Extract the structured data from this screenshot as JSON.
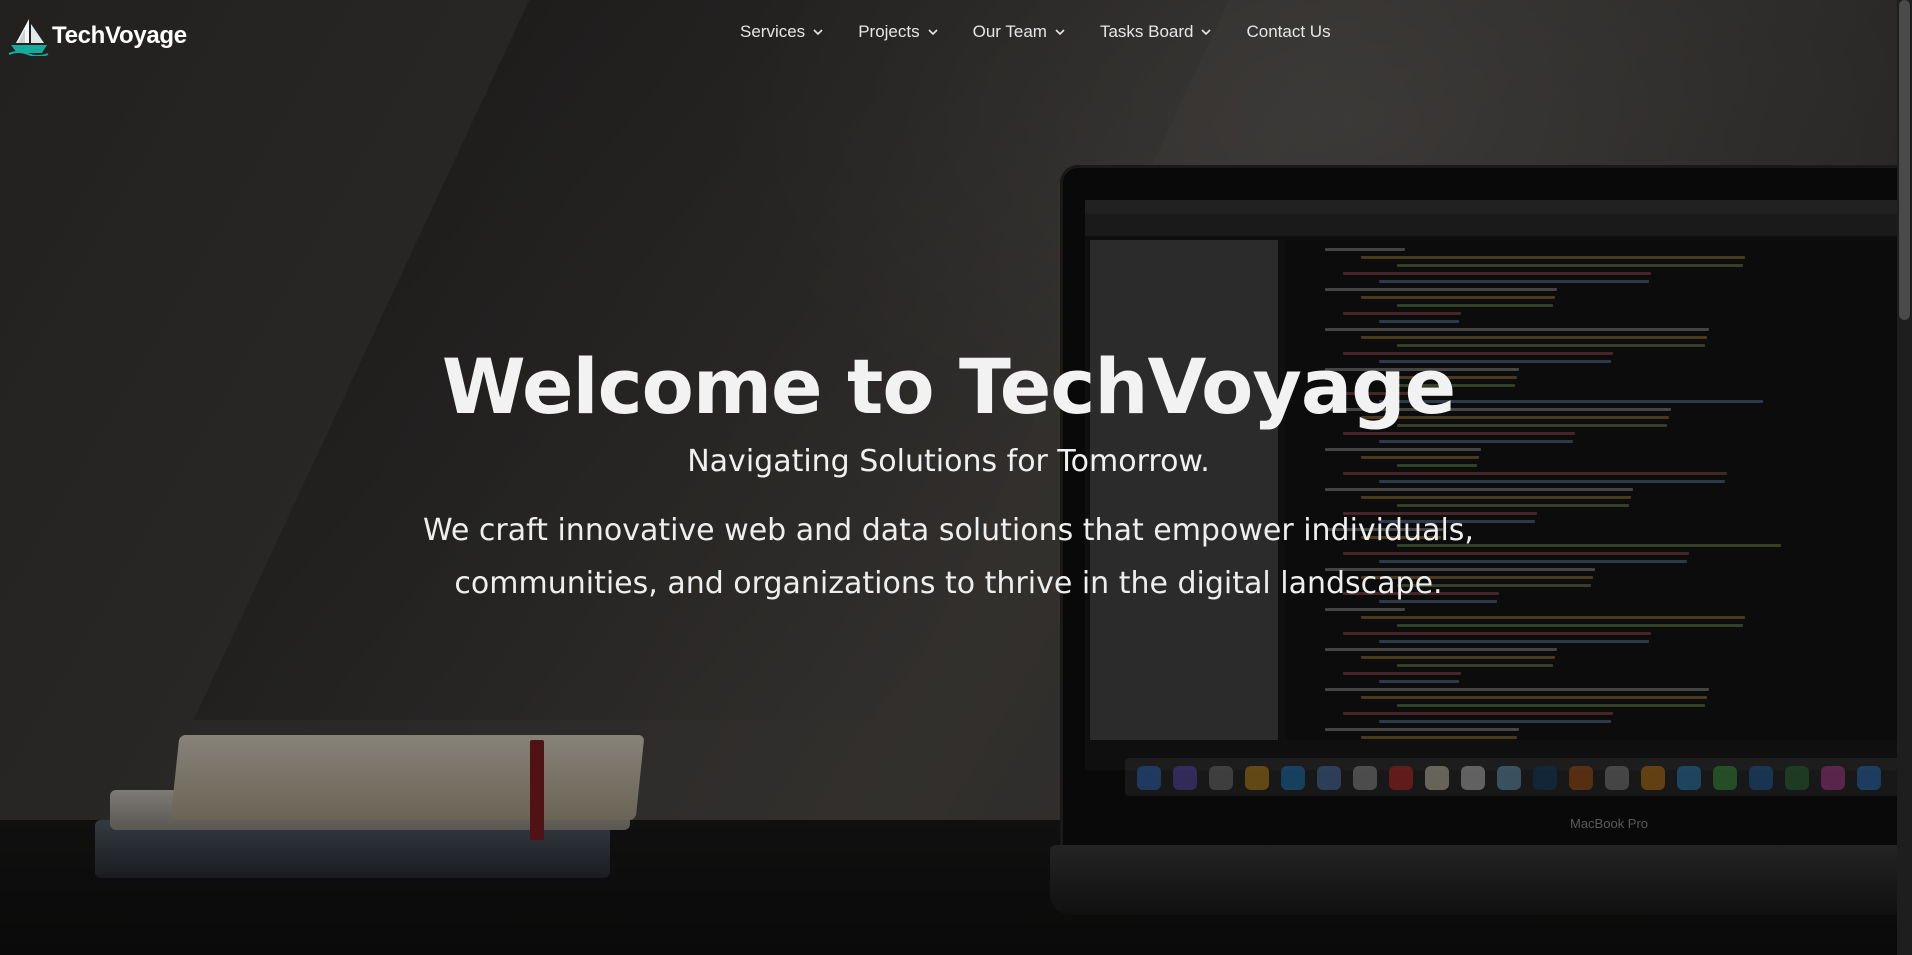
{
  "brand": {
    "name": "TechVoyage",
    "logo_icon": "sailboat-logo",
    "colors": {
      "sail": "#f3f7f9",
      "hull": "#17a99c"
    }
  },
  "nav": {
    "items": [
      {
        "label": "Services",
        "has_dropdown": true,
        "icon": "chevron-down-icon"
      },
      {
        "label": "Projects",
        "has_dropdown": true,
        "icon": "chevron-down-icon"
      },
      {
        "label": "Our Team",
        "has_dropdown": true,
        "icon": "chevron-down-icon"
      },
      {
        "label": "Tasks Board",
        "has_dropdown": true,
        "icon": "chevron-down-icon"
      },
      {
        "label": "Contact Us",
        "has_dropdown": false
      }
    ]
  },
  "hero": {
    "title": "Welcome to TechVoyage",
    "subtitle": "Navigating Solutions for Tomorrow.",
    "description": "We craft innovative web and data solutions that empower individuals, communities, and organizations to thrive in the digital landscape."
  },
  "background": {
    "laptop_brand": "MacBook Pro",
    "overlay_color": "#000000"
  }
}
